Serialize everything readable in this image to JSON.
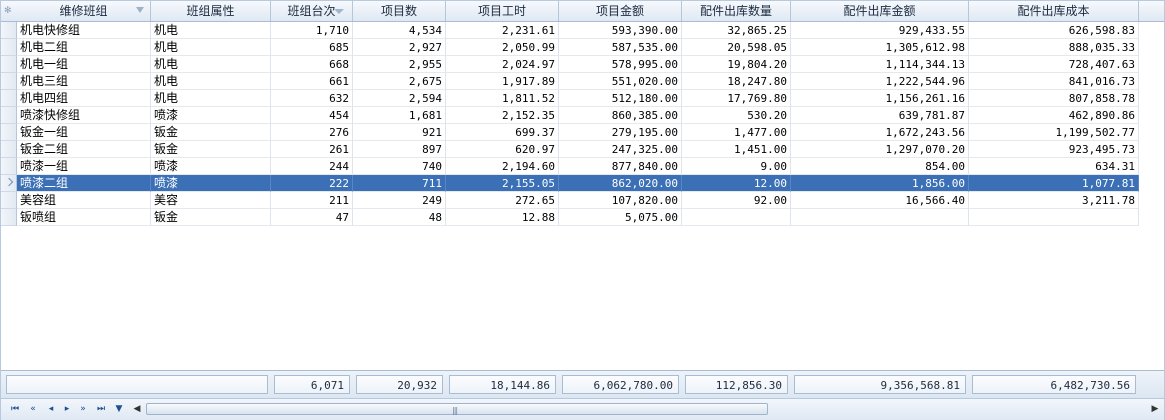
{
  "columns": [
    {
      "label": "维修班组",
      "key": "team"
    },
    {
      "label": "班组属性",
      "key": "attr"
    },
    {
      "label": "班组台次",
      "key": "count"
    },
    {
      "label": "项目数",
      "key": "items"
    },
    {
      "label": "项目工时",
      "key": "hours"
    },
    {
      "label": "项目金额",
      "key": "amount"
    },
    {
      "label": "配件出库数量",
      "key": "parts_qty"
    },
    {
      "label": "配件出库金额",
      "key": "parts_amount"
    },
    {
      "label": "配件出库成本",
      "key": "parts_cost"
    }
  ],
  "rows": [
    [
      "机电快修组",
      "机电",
      "1,710",
      "4,534",
      "2,231.61",
      "593,390.00",
      "32,865.25",
      "929,433.55",
      "626,598.83"
    ],
    [
      "机电二组",
      "机电",
      "685",
      "2,927",
      "2,050.99",
      "587,535.00",
      "20,598.05",
      "1,305,612.98",
      "888,035.33"
    ],
    [
      "机电一组",
      "机电",
      "668",
      "2,955",
      "2,024.97",
      "578,995.00",
      "19,804.20",
      "1,114,344.13",
      "728,407.63"
    ],
    [
      "机电三组",
      "机电",
      "661",
      "2,675",
      "1,917.89",
      "551,020.00",
      "18,247.80",
      "1,222,544.96",
      "841,016.73"
    ],
    [
      "机电四组",
      "机电",
      "632",
      "2,594",
      "1,811.52",
      "512,180.00",
      "17,769.80",
      "1,156,261.16",
      "807,858.78"
    ],
    [
      "喷漆快修组",
      "喷漆",
      "454",
      "1,681",
      "2,152.35",
      "860,385.00",
      "530.20",
      "639,781.87",
      "462,890.86"
    ],
    [
      "钣金一组",
      "钣金",
      "276",
      "921",
      "699.37",
      "279,195.00",
      "1,477.00",
      "1,672,243.56",
      "1,199,502.77"
    ],
    [
      "钣金二组",
      "钣金",
      "261",
      "897",
      "620.97",
      "247,325.00",
      "1,451.00",
      "1,297,070.20",
      "923,495.73"
    ],
    [
      "喷漆一组",
      "喷漆",
      "244",
      "740",
      "2,194.60",
      "877,840.00",
      "9.00",
      "854.00",
      "634.31"
    ],
    [
      "喷漆二组",
      "喷漆",
      "222",
      "711",
      "2,155.05",
      "862,020.00",
      "12.00",
      "1,856.00",
      "1,077.81"
    ],
    [
      "美容组",
      "美容",
      "211",
      "249",
      "272.65",
      "107,820.00",
      "92.00",
      "16,566.40",
      "3,211.78"
    ],
    [
      "钣喷组",
      "钣金",
      "47",
      "48",
      "12.88",
      "5,075.00",
      "",
      "",
      ""
    ]
  ],
  "selected_row": 9,
  "totals": [
    "6,071",
    "20,932",
    "18,144.86",
    "6,062,780.00",
    "112,856.30",
    "9,356,568.81",
    "6,482,730.56"
  ],
  "nav": {
    "first": "⏮",
    "prev_page": "«",
    "prev": "◂",
    "next": "▸",
    "next_page": "»",
    "last": "⏭",
    "filter": "▼"
  },
  "colors": {
    "selected_bg": "#3b6fb6",
    "header_bg": "#dfe8f3",
    "accent": "#1f4f92"
  },
  "icons": {
    "corner": "grid-corner-icon",
    "filter": "filter-icon",
    "sort": "sort-desc-icon"
  }
}
